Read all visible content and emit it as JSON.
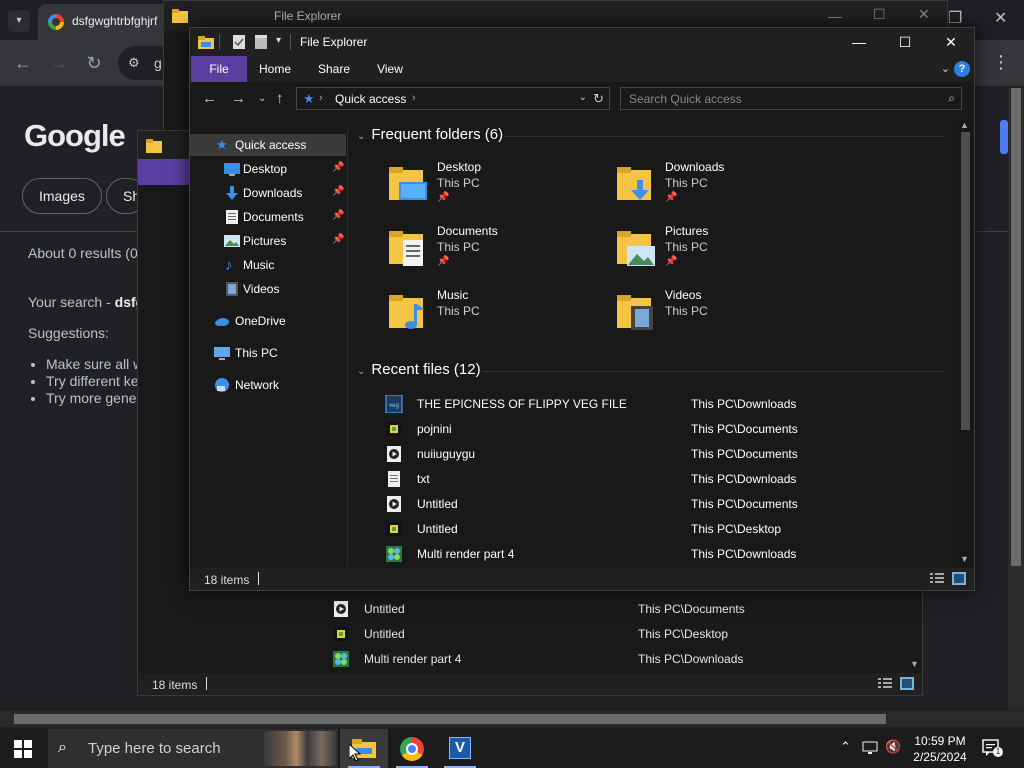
{
  "chrome": {
    "tab_title": "dsfgwghtrbfghjrf",
    "omnibox_text": "g",
    "logo": "Google",
    "chips": [
      "Images",
      "Sh"
    ],
    "results_info": "About 0 results (0",
    "search_prefix": "Your search - ",
    "search_term": "dsfg",
    "suggestions_label": "Suggestions:",
    "suggestions": [
      "Make sure all w",
      "Try different ke",
      "Try more gener"
    ]
  },
  "back_explorer": {
    "title": "File Explorer",
    "status_count": "18 items",
    "status_count_mid": "18",
    "rows": [
      {
        "name": "Untitled",
        "location": "This PC\\Documents",
        "icon": "media-file-icon"
      },
      {
        "name": "Untitled",
        "location": "This PC\\Desktop",
        "icon": "image-file-icon"
      },
      {
        "name": "Multi render part 4",
        "location": "This PC\\Downloads",
        "icon": "render-file-icon"
      }
    ]
  },
  "explorer": {
    "title": "File Explorer",
    "ribbon_tabs": [
      "File",
      "Home",
      "Share",
      "View"
    ],
    "help_label": "?",
    "address": {
      "location": "Quick access"
    },
    "search_placeholder": "Search Quick access",
    "sidebar": [
      {
        "label": "Quick access",
        "icon": "star-icon",
        "pinned": false,
        "active": true
      },
      {
        "label": "Desktop",
        "icon": "desktop-icon",
        "pinned": true
      },
      {
        "label": "Downloads",
        "icon": "download-icon",
        "pinned": true
      },
      {
        "label": "Documents",
        "icon": "documents-icon",
        "pinned": true
      },
      {
        "label": "Pictures",
        "icon": "pictures-icon",
        "pinned": true
      },
      {
        "label": "Music",
        "icon": "music-icon",
        "pinned": false
      },
      {
        "label": "Videos",
        "icon": "videos-icon",
        "pinned": false
      },
      {
        "label": "OneDrive",
        "icon": "cloud-icon",
        "pinned": false
      },
      {
        "label": "This PC",
        "icon": "computer-icon",
        "pinned": false
      },
      {
        "label": "Network",
        "icon": "network-icon",
        "pinned": false
      }
    ],
    "frequent_header": "Frequent folders (6)",
    "frequent": [
      {
        "name": "Desktop",
        "sub": "This PC",
        "pinned": true
      },
      {
        "name": "Downloads",
        "sub": "This PC",
        "pinned": true
      },
      {
        "name": "Documents",
        "sub": "This PC",
        "pinned": true
      },
      {
        "name": "Pictures",
        "sub": "This PC",
        "pinned": true
      },
      {
        "name": "Music",
        "sub": "This PC",
        "pinned": false
      },
      {
        "name": "Videos",
        "sub": "This PC",
        "pinned": false
      }
    ],
    "recent_header": "Recent files (12)",
    "recent": [
      {
        "name": "THE EPICNESS OF FLIPPY VEG FILE",
        "location": "This PC\\Downloads",
        "icon": "veg-file-icon"
      },
      {
        "name": "pojnini",
        "location": "This PC\\Documents",
        "icon": "image-file-icon"
      },
      {
        "name": "nuiiuguygu",
        "location": "This PC\\Documents",
        "icon": "media-file-icon"
      },
      {
        "name": "txt",
        "location": "This PC\\Downloads",
        "icon": "text-file-icon"
      },
      {
        "name": "Untitled",
        "location": "This PC\\Documents",
        "icon": "media-file-icon"
      },
      {
        "name": "Untitled",
        "location": "This PC\\Desktop",
        "icon": "image-file-icon"
      },
      {
        "name": "Multi render part 4",
        "location": "This PC\\Downloads",
        "icon": "render-file-icon"
      }
    ],
    "status_count": "18 items"
  },
  "taskbar": {
    "search_placeholder": "Type here to search",
    "time": "10:59 PM",
    "date": "2/25/2024",
    "apps": [
      "file-explorer-icon",
      "chrome-icon",
      "vegas-icon"
    ],
    "vegas_letter": "V"
  },
  "colors": {
    "accent_file_tab": "#5b3fa0",
    "folder_yellow": "#f4c542",
    "quick_access_blue": "#3b8fe8"
  }
}
